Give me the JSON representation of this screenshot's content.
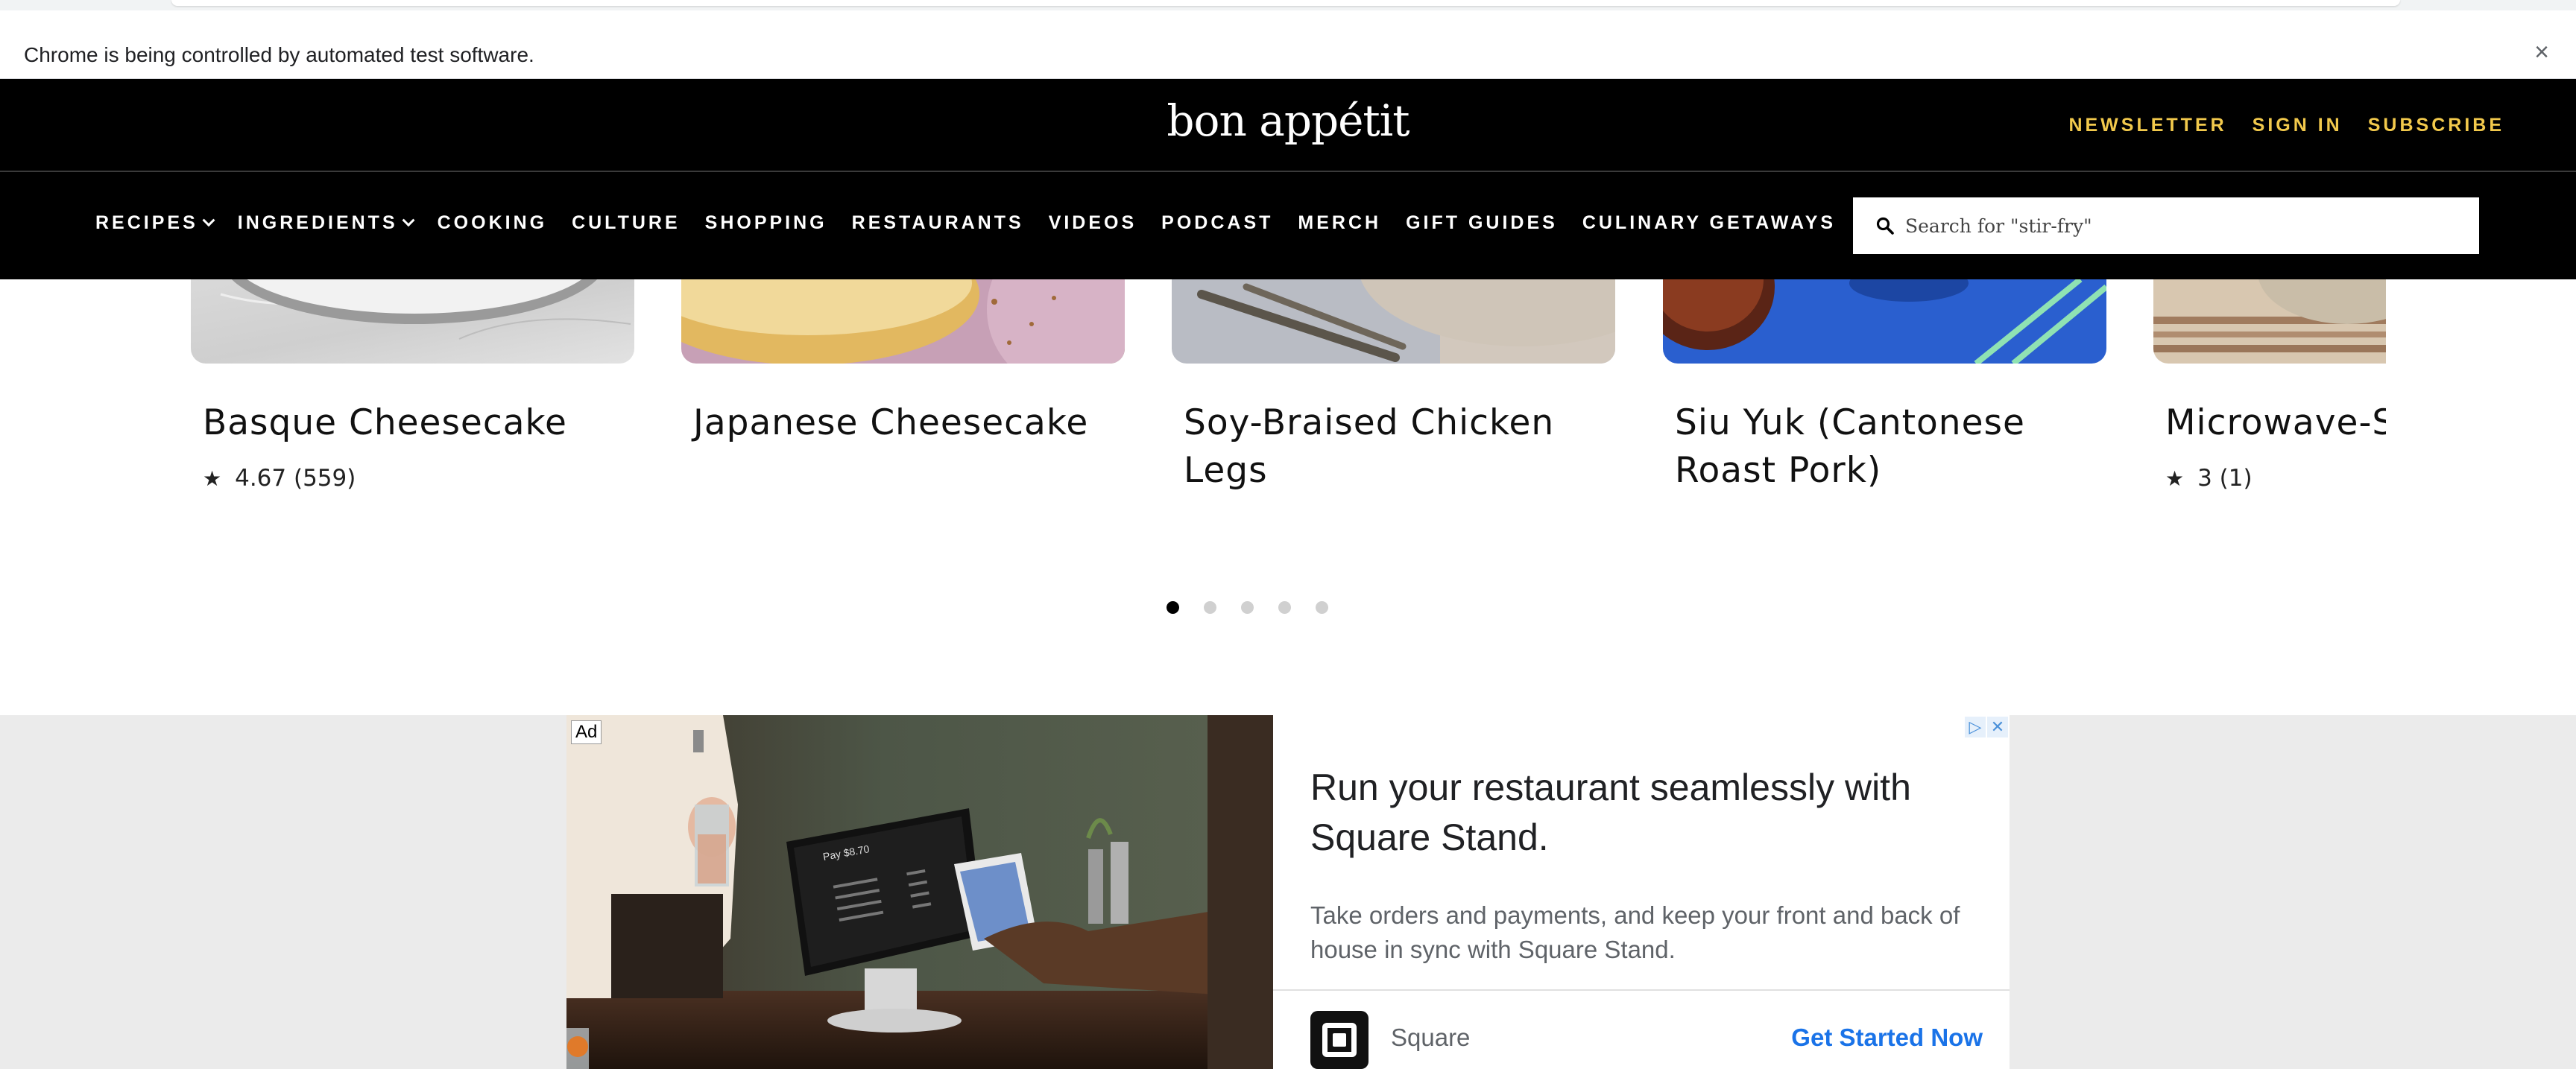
{
  "browser": {
    "infobar_text": "Chrome is being controlled by automated test software.",
    "close_glyph": "×"
  },
  "header": {
    "logo": "bon appétit",
    "links": [
      "NEWSLETTER",
      "SIGN IN",
      "SUBSCRIBE"
    ],
    "link_color": "#f2c94c"
  },
  "nav": {
    "items": [
      "RECIPES",
      "INGREDIENTS",
      "COOKING",
      "CULTURE",
      "SHOPPING",
      "RESTAURANTS",
      "VIDEOS",
      "PODCAST",
      "MERCH",
      "GIFT GUIDES",
      "CULINARY GETAWAYS"
    ],
    "dropdown_items": [
      "RECIPES",
      "INGREDIENTS"
    ],
    "search_placeholder": "Search for \"stir-fry\""
  },
  "carousel": {
    "cards": [
      {
        "title": "Basque Cheesecake",
        "rating": "4.67 (559)"
      },
      {
        "title": "Japanese Cheesecake",
        "rating": ""
      },
      {
        "title": "Soy-Braised Chicken Legs",
        "rating": ""
      },
      {
        "title": "Siu Yuk (Cantonese Roast Pork)",
        "rating": ""
      },
      {
        "title": "Microwave-St",
        "rating": "3 (1)"
      }
    ],
    "page_count": 5,
    "active_page": 1
  },
  "ad": {
    "badge": "Ad",
    "headline": "Run your restaurant seamlessly with Square Stand.",
    "description": "Take orders and payments, and keep your front and back of house in sync with Square Stand.",
    "brand": "Square",
    "cta": "Get Started Now",
    "photo_text": "Pay $8.70",
    "cta_color": "#1a73e8"
  }
}
